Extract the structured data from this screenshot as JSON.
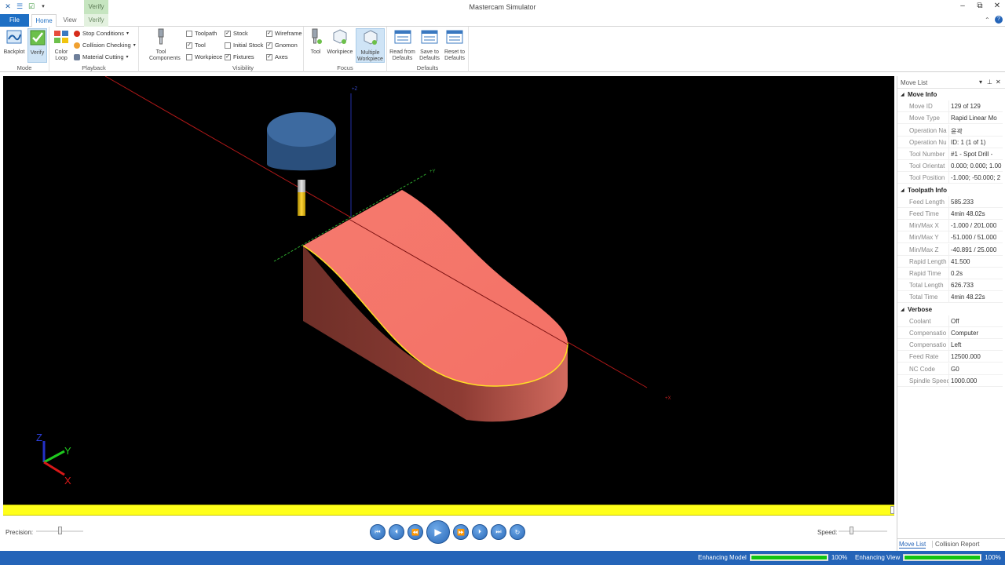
{
  "app": {
    "title": "Mastercam Simulator",
    "context_tab_title": "Verify",
    "window_controls": {
      "minimize": "–",
      "restore": "⧉",
      "close": "✕"
    }
  },
  "tabs": {
    "file": "File",
    "home": "Home",
    "view": "View",
    "verify": "Verify"
  },
  "ribbon": {
    "mode": {
      "label": "Mode",
      "backplot": "Backplot",
      "verify": "Verify"
    },
    "playback": {
      "label": "Playback",
      "color_loop": "Color Loop",
      "stop_conditions": "Stop Conditions",
      "collision_checking": "Collision Checking",
      "material_cutting": "Material Cutting"
    },
    "tool_components": "Tool Components",
    "visibility": {
      "label": "Visibility",
      "toolpath": "Toolpath",
      "toolpath_checked": false,
      "tool": "Tool",
      "tool_checked": true,
      "workpiece": "Workpiece",
      "workpiece_checked": false,
      "stock": "Stock",
      "stock_checked": true,
      "initial_stock": "Initial Stock",
      "initial_stock_checked": false,
      "fixtures": "Fixtures",
      "fixtures_checked": true,
      "wireframe": "Wireframe",
      "wireframe_checked": true,
      "gnomon": "Gnomon",
      "gnomon_checked": true,
      "axes": "Axes",
      "axes_checked": true
    },
    "focus": {
      "label": "Focus",
      "tool": "Tool",
      "workpiece": "Workpiece",
      "multiple_workpiece": "Multiple Workpiece"
    },
    "defaults": {
      "label": "Defaults",
      "read_from_defaults": "Read from Defaults",
      "save_to_defaults": "Save to Defaults",
      "reset_to_defaults": "Reset to Defaults"
    }
  },
  "viewport": {
    "axis_labels": {
      "z": "+Z",
      "y": "+Y",
      "x": "+X"
    },
    "gnomon": {
      "z": "Z",
      "y": "Y",
      "x": "X"
    }
  },
  "playback_bar": {
    "precision_label": "Precision:",
    "speed_label": "Speed:",
    "progress_fraction": 1.0
  },
  "statusbar": {
    "enhancing_model_label": "Enhancing Model",
    "enhancing_model_value": "100%",
    "enhancing_model_fraction": 1.0,
    "enhancing_view_label": "Enhancing View",
    "enhancing_view_value": "100%",
    "enhancing_view_fraction": 1.0
  },
  "panel": {
    "title": "Move List",
    "move_info": {
      "label": "Move Info",
      "rows": [
        {
          "name": "Move ID",
          "value": "129 of 129"
        },
        {
          "name": "Move Type",
          "value": "Rapid Linear Mo"
        },
        {
          "name": "Operation Na",
          "value": "윤곽"
        },
        {
          "name": "Operation Nu",
          "value": "ID: 1 (1 of 1)"
        },
        {
          "name": "Tool Number",
          "value": "#1 - Spot Drill - "
        },
        {
          "name": "Tool Orientat",
          "value": "0.000; 0.000; 1.00"
        },
        {
          "name": "Tool Position",
          "value": "-1.000; -50.000; 2"
        }
      ]
    },
    "toolpath_info": {
      "label": "Toolpath Info",
      "rows": [
        {
          "name": "Feed Length",
          "value": "585.233"
        },
        {
          "name": "Feed Time",
          "value": "4min 48.02s"
        },
        {
          "name": "Min/Max X",
          "value": "-1.000 / 201.000"
        },
        {
          "name": "Min/Max Y",
          "value": "-51.000 / 51.000"
        },
        {
          "name": "Min/Max Z",
          "value": "-40.891 / 25.000"
        },
        {
          "name": "Rapid Length",
          "value": "41.500"
        },
        {
          "name": "Rapid Time",
          "value": "0.2s"
        },
        {
          "name": "Total Length",
          "value": "626.733"
        },
        {
          "name": "Total Time",
          "value": "4min 48.22s"
        }
      ]
    },
    "verbose": {
      "label": "Verbose",
      "rows": [
        {
          "name": "Coolant",
          "value": "Off"
        },
        {
          "name": "Compensatio",
          "value": "Computer"
        },
        {
          "name": "Compensatio",
          "value": "Left"
        },
        {
          "name": "Feed Rate",
          "value": "12500.000"
        },
        {
          "name": "NC Code",
          "value": "G0"
        },
        {
          "name": "Spindle Speed",
          "value": "1000.000"
        }
      ]
    },
    "tabs": {
      "move_list": "Move List",
      "collision_report": "Collision Report"
    }
  }
}
